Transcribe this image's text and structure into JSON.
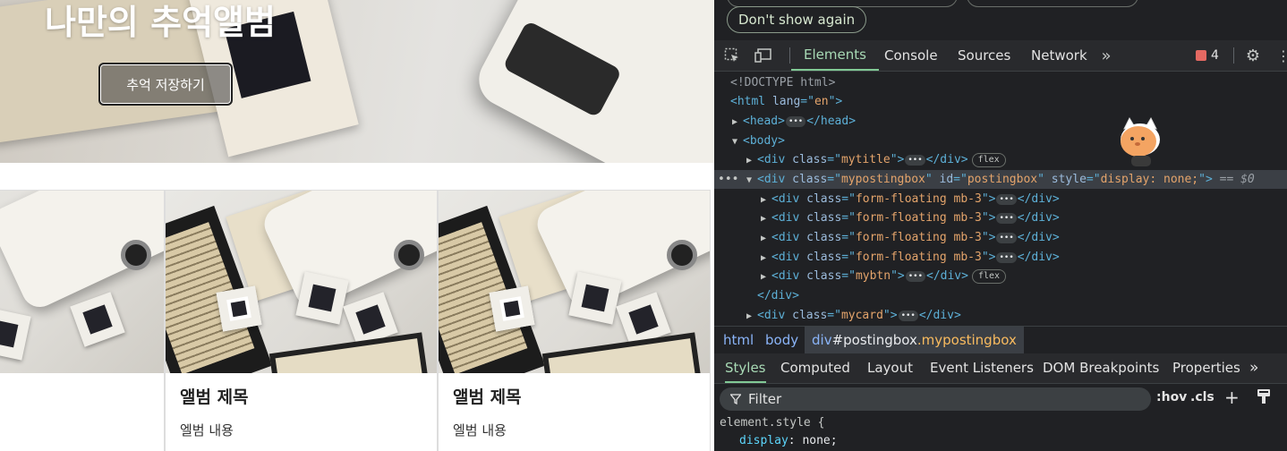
{
  "page": {
    "hero_title": "나만의 추억앨범",
    "save_button": "추억 저장하기",
    "cards": [
      {
        "title": "",
        "text": ""
      },
      {
        "title": "앨범 제목",
        "text": "엘범 내용"
      },
      {
        "title": "앨범 제목",
        "text": "엘범 내용"
      }
    ]
  },
  "devtools": {
    "dont_show_again": "Don't show again",
    "tabs": [
      "Elements",
      "Console",
      "Sources",
      "Network"
    ],
    "active_tab": "Elements",
    "issues_count": "4",
    "dom": {
      "doctype": "<!DOCTYPE html>",
      "html_open": [
        "<html",
        " lang",
        "=\"",
        "en",
        "\">"
      ],
      "head": [
        "<head>",
        "</head>"
      ],
      "body": "<body>",
      "mytitle": {
        "tag": "<div",
        "attr": " class",
        "val": "mytitle",
        "close": "</div>",
        "badge": "flex"
      },
      "postingbox": {
        "class_val": "mypostingbox",
        "id_val": "postingbox",
        "style_val": "display: none;",
        "eq": "== $0"
      },
      "children": [
        {
          "class_val": "form-floating mb-3"
        },
        {
          "class_val": "form-floating mb-3"
        },
        {
          "class_val": "form-floating mb-3"
        },
        {
          "class_val": "form-floating mb-3"
        }
      ],
      "mybtn": {
        "class_val": "mybtn",
        "badge": "flex"
      },
      "div_close": "</div>",
      "mycard": {
        "class_val": "mycard"
      }
    },
    "breadcrumbs": {
      "html": "html",
      "body": "body",
      "active_tag": "div",
      "active_id": "#postingbox",
      "active_class": ".mypostingbox"
    },
    "subtabs": [
      "Styles",
      "Computed",
      "Layout",
      "Event Listeners",
      "DOM Breakpoints",
      "Properties"
    ],
    "active_subtab": "Styles",
    "filter_placeholder": "Filter",
    "hov": ":hov",
    "cls": ".cls",
    "styles": {
      "selector": "element.style {",
      "prop": "display",
      "value": "none;"
    }
  },
  "colors": {
    "devtools_bg": "#202124",
    "active_tab_green": "#a8dab5",
    "tag_blue": "#5db0d7",
    "attr_value_orange": "#f29766",
    "issue_red": "#e46962"
  }
}
